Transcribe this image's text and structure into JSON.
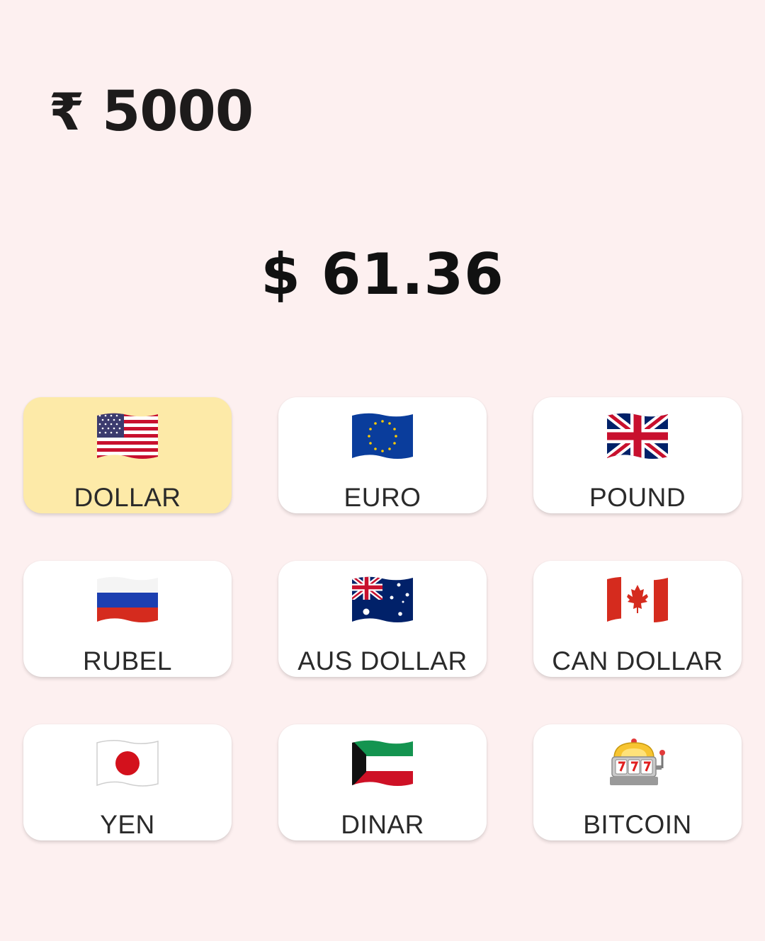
{
  "input": {
    "currency_symbol": "₹",
    "amount": "5000"
  },
  "result": {
    "text": "$ 61.36"
  },
  "currencies": [
    {
      "label": "DOLLAR",
      "icon": "us-flag-icon",
      "selected": true
    },
    {
      "label": "EURO",
      "icon": "eu-flag-icon",
      "selected": false
    },
    {
      "label": "POUND",
      "icon": "uk-flag-icon",
      "selected": false
    },
    {
      "label": "RUBEL",
      "icon": "russia-flag-icon",
      "selected": false
    },
    {
      "label": "AUS DOLLAR",
      "icon": "australia-flag-icon",
      "selected": false
    },
    {
      "label": "CAN DOLLAR",
      "icon": "canada-flag-icon",
      "selected": false
    },
    {
      "label": "YEN",
      "icon": "japan-flag-icon",
      "selected": false
    },
    {
      "label": "DINAR",
      "icon": "kuwait-flag-icon",
      "selected": false
    },
    {
      "label": "BITCOIN",
      "icon": "slot-machine-icon",
      "selected": false
    }
  ],
  "colors": {
    "background": "#fdf0f0",
    "card": "#ffffff",
    "selected_card": "#fdeaa8",
    "text": "#1d1b1b"
  }
}
